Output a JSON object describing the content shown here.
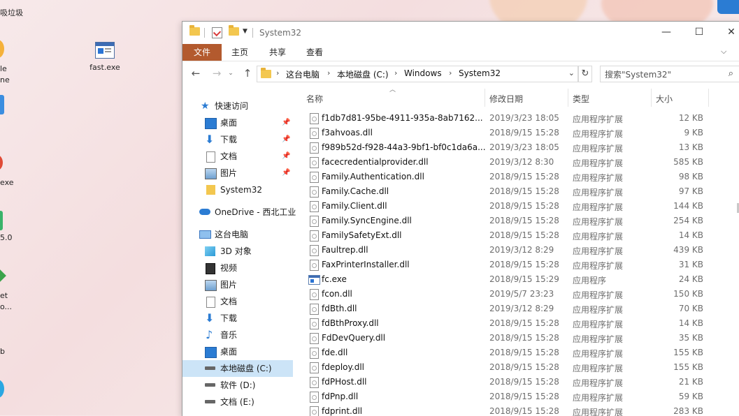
{
  "desktop": {
    "icons": [
      {
        "label": "fast.exe"
      }
    ],
    "partial_labels": [
      "吸垃圾",
      "le",
      "ne",
      "exe",
      "5.0",
      "et",
      "o...",
      "b"
    ]
  },
  "window": {
    "title": "System32",
    "controls": {
      "minimize": "—",
      "maximize": "☐",
      "close": "✕"
    },
    "ribbon_tabs": [
      "文件",
      "主页",
      "共享",
      "查看"
    ]
  },
  "address": {
    "path": [
      "这台电脑",
      "本地磁盘 (C:)",
      "Windows",
      "System32"
    ],
    "search_placeholder": "搜索\"System32\""
  },
  "nav": {
    "quick_access": "快速访问",
    "quick_items": [
      {
        "label": "桌面",
        "icon": "desktop-icon",
        "pinned": true
      },
      {
        "label": "下载",
        "icon": "download-icon",
        "pinned": true
      },
      {
        "label": "文档",
        "icon": "document-icon",
        "pinned": true
      },
      {
        "label": "图片",
        "icon": "picture-icon",
        "pinned": true
      },
      {
        "label": "System32",
        "icon": "folder-icon",
        "pinned": false
      }
    ],
    "onedrive": "OneDrive - 西北工业",
    "this_pc": "这台电脑",
    "pc_items": [
      {
        "label": "3D 对象",
        "icon": "cube-icon"
      },
      {
        "label": "视频",
        "icon": "video-icon"
      },
      {
        "label": "图片",
        "icon": "picture-icon"
      },
      {
        "label": "文档",
        "icon": "document-icon"
      },
      {
        "label": "下载",
        "icon": "download-icon"
      },
      {
        "label": "音乐",
        "icon": "music-icon"
      },
      {
        "label": "桌面",
        "icon": "desktop-icon"
      },
      {
        "label": "本地磁盘 (C:)",
        "icon": "drive-icon",
        "selected": true
      },
      {
        "label": "软件 (D:)",
        "icon": "drive-icon"
      },
      {
        "label": "文档 (E:)",
        "icon": "drive-icon"
      }
    ]
  },
  "list": {
    "columns": [
      "名称",
      "修改日期",
      "类型",
      "大小"
    ],
    "rows": [
      {
        "name": "f1db7d81-95be-4911-935a-8ab7162...",
        "date": "2019/3/23 18:05",
        "type": "应用程序扩展",
        "size": "12 KB"
      },
      {
        "name": "f3ahvoas.dll",
        "date": "2018/9/15 15:28",
        "type": "应用程序扩展",
        "size": "9 KB"
      },
      {
        "name": "f989b52d-f928-44a3-9bf1-bf0c1da6a...",
        "date": "2019/3/23 18:05",
        "type": "应用程序扩展",
        "size": "13 KB"
      },
      {
        "name": "facecredentialprovider.dll",
        "date": "2019/3/12 8:30",
        "type": "应用程序扩展",
        "size": "585 KB"
      },
      {
        "name": "Family.Authentication.dll",
        "date": "2018/9/15 15:28",
        "type": "应用程序扩展",
        "size": "98 KB"
      },
      {
        "name": "Family.Cache.dll",
        "date": "2018/9/15 15:28",
        "type": "应用程序扩展",
        "size": "97 KB"
      },
      {
        "name": "Family.Client.dll",
        "date": "2018/9/15 15:28",
        "type": "应用程序扩展",
        "size": "144 KB"
      },
      {
        "name": "Family.SyncEngine.dll",
        "date": "2018/9/15 15:28",
        "type": "应用程序扩展",
        "size": "254 KB"
      },
      {
        "name": "FamilySafetyExt.dll",
        "date": "2018/9/15 15:28",
        "type": "应用程序扩展",
        "size": "14 KB"
      },
      {
        "name": "Faultrep.dll",
        "date": "2019/3/12 8:29",
        "type": "应用程序扩展",
        "size": "439 KB"
      },
      {
        "name": "FaxPrinterInstaller.dll",
        "date": "2018/9/15 15:28",
        "type": "应用程序扩展",
        "size": "31 KB"
      },
      {
        "name": "fc.exe",
        "date": "2018/9/15 15:29",
        "type": "应用程序",
        "size": "24 KB",
        "exe": true
      },
      {
        "name": "fcon.dll",
        "date": "2019/5/7 23:23",
        "type": "应用程序扩展",
        "size": "150 KB"
      },
      {
        "name": "fdBth.dll",
        "date": "2019/3/12 8:29",
        "type": "应用程序扩展",
        "size": "70 KB"
      },
      {
        "name": "fdBthProxy.dll",
        "date": "2018/9/15 15:28",
        "type": "应用程序扩展",
        "size": "14 KB"
      },
      {
        "name": "FdDevQuery.dll",
        "date": "2018/9/15 15:28",
        "type": "应用程序扩展",
        "size": "35 KB"
      },
      {
        "name": "fde.dll",
        "date": "2018/9/15 15:28",
        "type": "应用程序扩展",
        "size": "155 KB"
      },
      {
        "name": "fdeploy.dll",
        "date": "2018/9/15 15:28",
        "type": "应用程序扩展",
        "size": "155 KB"
      },
      {
        "name": "fdPHost.dll",
        "date": "2018/9/15 15:28",
        "type": "应用程序扩展",
        "size": "21 KB"
      },
      {
        "name": "fdPnp.dll",
        "date": "2018/9/15 15:28",
        "type": "应用程序扩展",
        "size": "59 KB"
      },
      {
        "name": "fdprint.dll",
        "date": "2018/9/15 15:28",
        "type": "应用程序扩展",
        "size": "283 KB"
      }
    ]
  },
  "colors": {
    "file_tab": "#b35a2e",
    "selection": "#cce4f7",
    "folder": "#f3c74f",
    "onedrive": "#2b7cd3"
  }
}
